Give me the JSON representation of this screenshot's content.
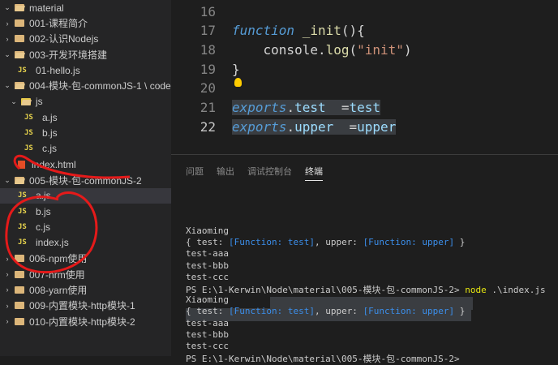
{
  "sidebar": {
    "root": "material",
    "items": [
      {
        "label": "001-课程简介",
        "kind": "folder"
      },
      {
        "label": "002-认识Nodejs",
        "kind": "folder"
      },
      {
        "label": "003-开发环境搭建",
        "kind": "folder-open"
      },
      {
        "label": "01-hello.js",
        "kind": "js"
      },
      {
        "label": "004-模块-包-commonJS-1 \\ code",
        "kind": "folder-open"
      },
      {
        "label": "js",
        "kind": "jsfolder"
      },
      {
        "label": "a.js",
        "kind": "js"
      },
      {
        "label": "b.js",
        "kind": "js"
      },
      {
        "label": "c.js",
        "kind": "js"
      },
      {
        "label": "index.html",
        "kind": "html"
      },
      {
        "label": "005-模块-包-commonJS-2",
        "kind": "folder-open"
      },
      {
        "label": "a.js",
        "kind": "js"
      },
      {
        "label": "b.js",
        "kind": "js"
      },
      {
        "label": "c.js",
        "kind": "js"
      },
      {
        "label": "index.js",
        "kind": "js"
      },
      {
        "label": "006-npm使用",
        "kind": "folder"
      },
      {
        "label": "007-nrm使用",
        "kind": "folder"
      },
      {
        "label": "008-yarn使用",
        "kind": "folder"
      },
      {
        "label": "009-内置模块-http模块-1",
        "kind": "folder"
      },
      {
        "label": "010-内置模块-http模块-2",
        "kind": "folder"
      }
    ]
  },
  "editor": {
    "lines": [
      {
        "n": "16",
        "tokens": []
      },
      {
        "n": "17",
        "tokens": [
          {
            "t": "function",
            "c": "kw"
          },
          {
            "t": " ",
            "c": "plain"
          },
          {
            "t": "_init",
            "c": "fn"
          },
          {
            "t": "(){",
            "c": "plain"
          }
        ]
      },
      {
        "n": "18",
        "tokens": [
          {
            "t": "    console.",
            "c": "plain"
          },
          {
            "t": "log",
            "c": "fn"
          },
          {
            "t": "(",
            "c": "plain"
          },
          {
            "t": "\"init\"",
            "c": "str"
          },
          {
            "t": ")",
            "c": "plain"
          }
        ]
      },
      {
        "n": "19",
        "tokens": [
          {
            "t": "}",
            "c": "plain"
          }
        ]
      },
      {
        "n": "20",
        "tokens": []
      },
      {
        "n": "21",
        "tokens": [
          {
            "t": "exports",
            "c": "kw"
          },
          {
            "t": ".",
            "c": "plain"
          },
          {
            "t": "test",
            "c": "prop"
          },
          {
            "t": "  =",
            "c": "plain"
          },
          {
            "t": "test",
            "c": "prop"
          }
        ]
      },
      {
        "n": "22",
        "tokens": [
          {
            "t": "exports",
            "c": "kw"
          },
          {
            "t": ".",
            "c": "plain"
          },
          {
            "t": "upper",
            "c": "prop"
          },
          {
            "t": "  =",
            "c": "plain"
          },
          {
            "t": "upper",
            "c": "prop"
          }
        ]
      }
    ]
  },
  "panel": {
    "tabs": [
      "问题",
      "输出",
      "调试控制台",
      "终端"
    ],
    "active_tab": "终端"
  },
  "terminal": {
    "lines": [
      "Xiaoming",
      "{ test: [Function: test], upper: [Function: upper] }",
      "test-aaa",
      "test-bbb",
      "test-ccc",
      "PS E:\\1-Kerwin\\Node\\material\\005-模块-包-commonJS-2> node .\\index.js",
      "Xiaoming",
      "{ test: [Function: test], upper: [Function: upper] }",
      "test-aaa",
      "test-bbb",
      "test-ccc",
      "PS E:\\1-Kerwin\\Node\\material\\005-模块-包-commonJS-2> "
    ]
  },
  "colors": {
    "keyword": "#569cd6",
    "function": "#dcdcaa",
    "string": "#ce9178",
    "property": "#9cdcfe",
    "annotation": "#e51a1a"
  }
}
